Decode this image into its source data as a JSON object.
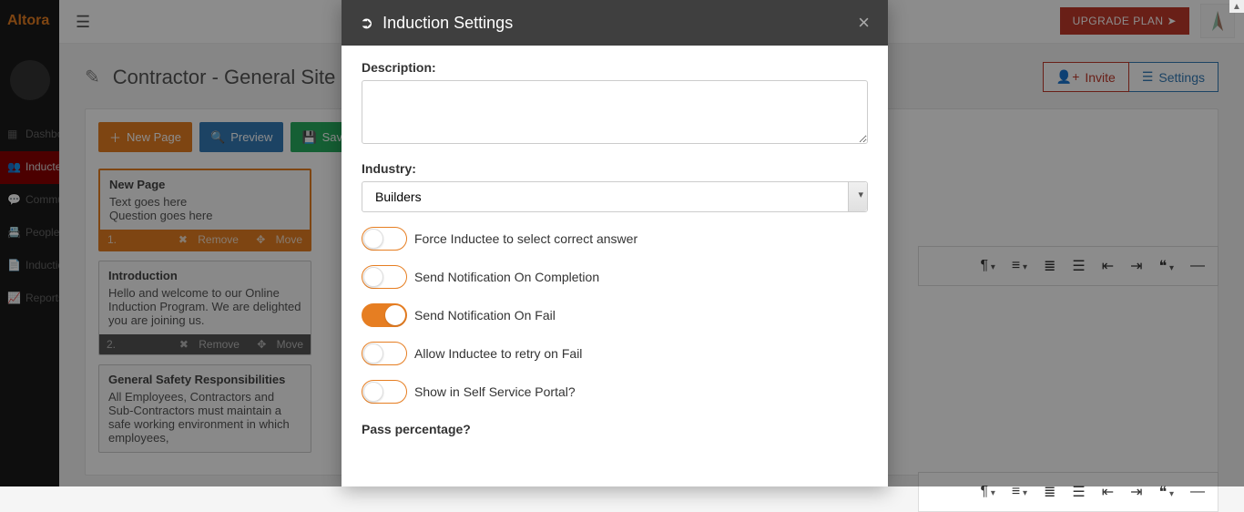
{
  "brand": "Altora",
  "topbar": {
    "upgrade_label": "UPGRADE PLAN"
  },
  "nav": {
    "items": [
      {
        "label": "Dashboard"
      },
      {
        "label": "Inductees"
      },
      {
        "label": "Communicate"
      },
      {
        "label": "People"
      },
      {
        "label": "Inductions"
      },
      {
        "label": "Reports"
      }
    ]
  },
  "page": {
    "title": "Contractor - General Site In",
    "invite_label": "Invite",
    "settings_label": "Settings"
  },
  "toolbar": {
    "new_page": "New Page",
    "preview": "Preview",
    "save": "Save"
  },
  "pages": [
    {
      "index": "1.",
      "title": "New Page",
      "body1": "Text goes here",
      "body2": "Question goes here",
      "remove": "Remove",
      "move": "Move",
      "selected": true
    },
    {
      "index": "2.",
      "title": "Introduction",
      "body1": "Hello and welcome to our Online Induction Program. We are delighted you are joining us.",
      "body2": "",
      "remove": "Remove",
      "move": "Move",
      "selected": false
    },
    {
      "index": "",
      "title": "General Safety Responsibilities",
      "body1": "All Employees, Contractors and Sub-Contractors must maintain a safe working environment in which employees,",
      "body2": "",
      "remove": "",
      "move": "",
      "selected": false
    }
  ],
  "modal": {
    "title": "Induction Settings",
    "description_label": "Description:",
    "description_value": "",
    "industry_label": "Industry:",
    "industry_value": "Builders",
    "toggles": [
      {
        "label": "Force Inductee to select correct answer",
        "on": false
      },
      {
        "label": "Send Notification On Completion",
        "on": false
      },
      {
        "label": "Send Notification On Fail",
        "on": true
      },
      {
        "label": "Allow Inductee to retry on Fail",
        "on": false
      },
      {
        "label": "Show in Self Service Portal?",
        "on": false
      }
    ],
    "pass_label": "Pass percentage?"
  }
}
